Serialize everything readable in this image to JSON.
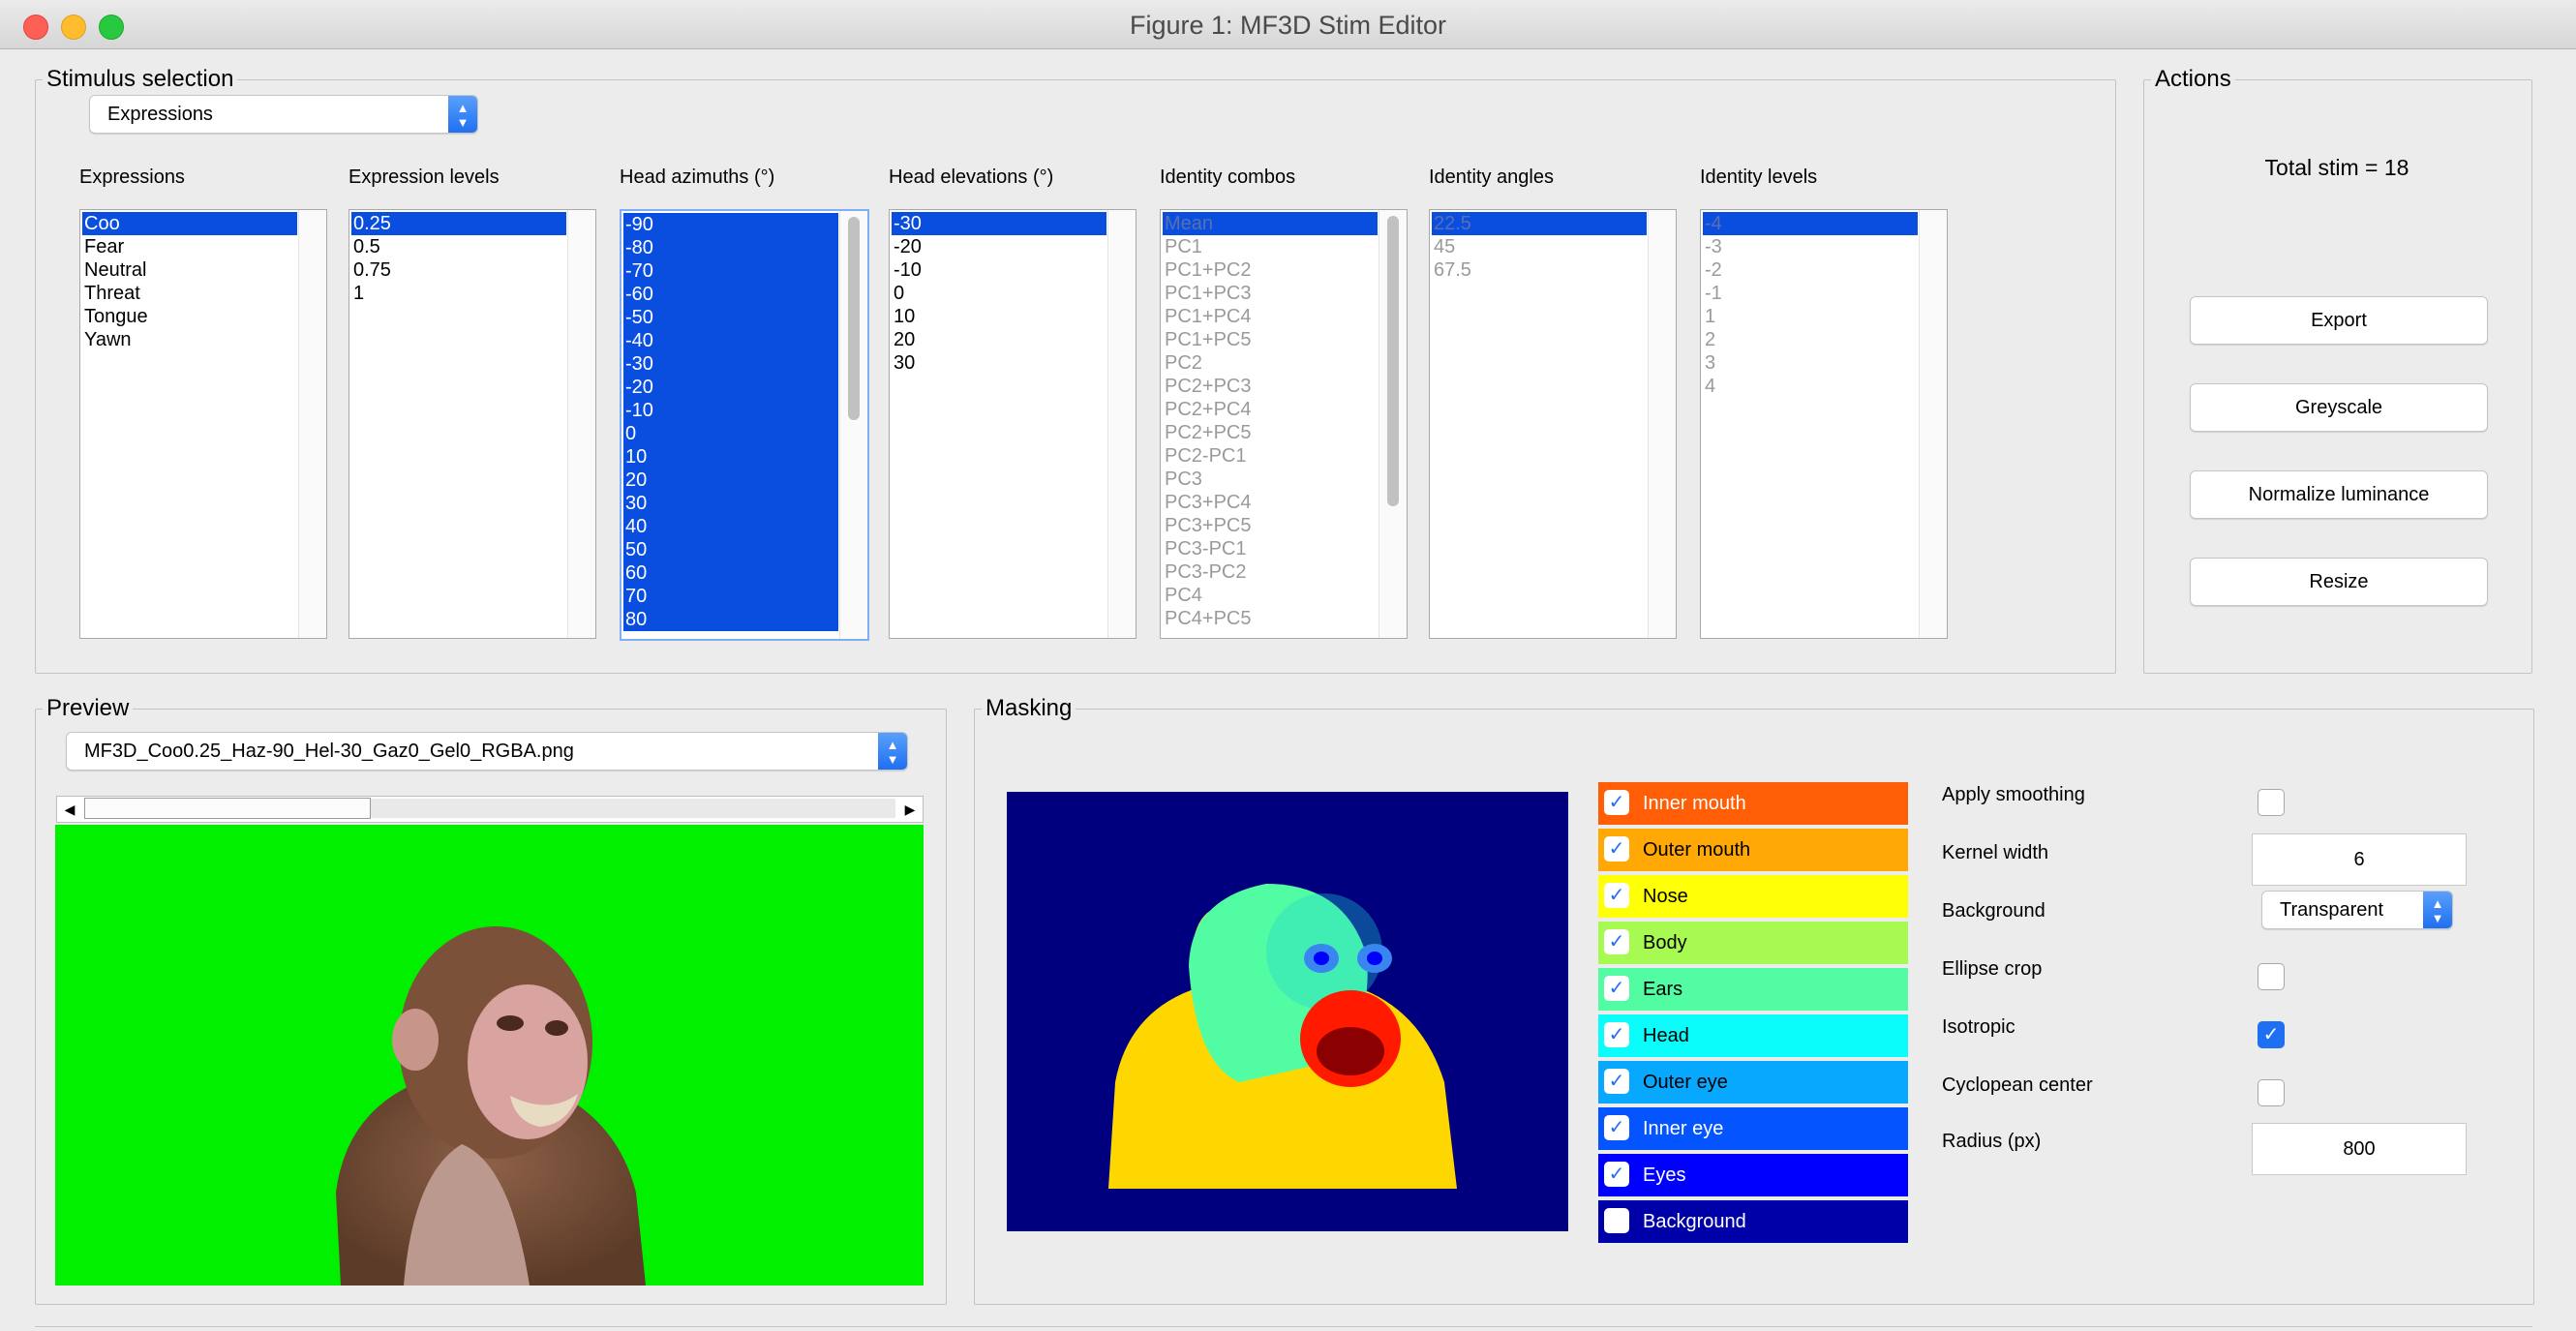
{
  "window": {
    "title": "Figure 1: MF3D Stim Editor"
  },
  "stimulus_selection": {
    "legend": "Stimulus selection",
    "type_select": "Expressions",
    "columns": [
      {
        "header": "Expressions",
        "items": [
          "Coo",
          "Fear",
          "Neutral",
          "Threat",
          "Tongue",
          "Yawn"
        ],
        "selected": [
          0
        ],
        "disabled": false
      },
      {
        "header": "Expression levels",
        "items": [
          "0.25",
          "0.5",
          "0.75",
          "1"
        ],
        "selected": [
          0
        ],
        "disabled": false
      },
      {
        "header": "Head azimuths (°)",
        "items": [
          "-90",
          "-80",
          "-70",
          "-60",
          "-50",
          "-40",
          "-30",
          "-20",
          "-10",
          "0",
          "10",
          "20",
          "30",
          "40",
          "50",
          "60",
          "70",
          "80"
        ],
        "selected": [
          0,
          1,
          2,
          3,
          4,
          5,
          6,
          7,
          8,
          9,
          10,
          11,
          12,
          13,
          14,
          15,
          16,
          17
        ],
        "disabled": false
      },
      {
        "header": "Head elevations (°)",
        "items": [
          "-30",
          "-20",
          "-10",
          "0",
          "10",
          "20",
          "30"
        ],
        "selected": [
          0
        ],
        "disabled": false
      },
      {
        "header": "Identity combos",
        "items": [
          "Mean",
          "PC1",
          "PC1+PC2",
          "PC1+PC3",
          "PC1+PC4",
          "PC1+PC5",
          "PC2",
          "PC2+PC3",
          "PC2+PC4",
          "PC2+PC5",
          "PC2-PC1",
          "PC3",
          "PC3+PC4",
          "PC3+PC5",
          "PC3-PC1",
          "PC3-PC2",
          "PC4",
          "PC4+PC5"
        ],
        "selected": [
          0
        ],
        "disabled": true
      },
      {
        "header": "Identity angles",
        "items": [
          "22.5",
          "45",
          "67.5"
        ],
        "selected": [
          0
        ],
        "disabled": true
      },
      {
        "header": "Identity levels",
        "items": [
          "-4",
          "-3",
          "-2",
          "-1",
          "1",
          "2",
          "3",
          "4"
        ],
        "selected": [
          0
        ],
        "disabled": true
      }
    ]
  },
  "actions": {
    "legend": "Actions",
    "total": "Total stim = 18",
    "buttons": [
      "Export",
      "Greyscale",
      "Normalize luminance",
      "Resize"
    ]
  },
  "preview": {
    "legend": "Preview",
    "file": "MF3D_Coo0.25_Haz-90_Hel-30_Gaz0_Gel0_RGBA.png",
    "slider_position": 0.0,
    "background_color": "#00f000"
  },
  "masking": {
    "legend": "Masking",
    "regions": [
      {
        "label": "Inner mouth",
        "color": "#ff5e07",
        "checked": true,
        "light_text": true
      },
      {
        "label": "Outer mouth",
        "color": "#ffa806",
        "checked": true,
        "light_text": false
      },
      {
        "label": "Nose",
        "color": "#ffff08",
        "checked": true,
        "light_text": false
      },
      {
        "label": "Body",
        "color": "#a6fa52",
        "checked": true,
        "light_text": false
      },
      {
        "label": "Ears",
        "color": "#52fca3",
        "checked": true,
        "light_text": false
      },
      {
        "label": "Head",
        "color": "#0bfdfb",
        "checked": true,
        "light_text": false
      },
      {
        "label": "Outer eye",
        "color": "#07a8fd",
        "checked": true,
        "light_text": false
      },
      {
        "label": "Inner eye",
        "color": "#0454ff",
        "checked": true,
        "light_text": true
      },
      {
        "label": "Eyes",
        "color": "#0000fe",
        "checked": true,
        "light_text": true
      },
      {
        "label": "Background",
        "color": "#0000a8",
        "checked": false,
        "light_text": true
      }
    ],
    "options": {
      "apply_smoothing": {
        "label": "Apply smoothing",
        "checked": false
      },
      "kernel_width": {
        "label": "Kernel width",
        "value": "6"
      },
      "background": {
        "label": "Background",
        "value": "Transparent"
      },
      "ellipse_crop": {
        "label": "Ellipse crop",
        "checked": false
      },
      "isotropic": {
        "label": "Isotropic",
        "checked": true
      },
      "cyclopean_center": {
        "label": "Cyclopean center",
        "checked": false
      },
      "radius": {
        "label": "Radius (px)",
        "value": "800"
      }
    }
  }
}
